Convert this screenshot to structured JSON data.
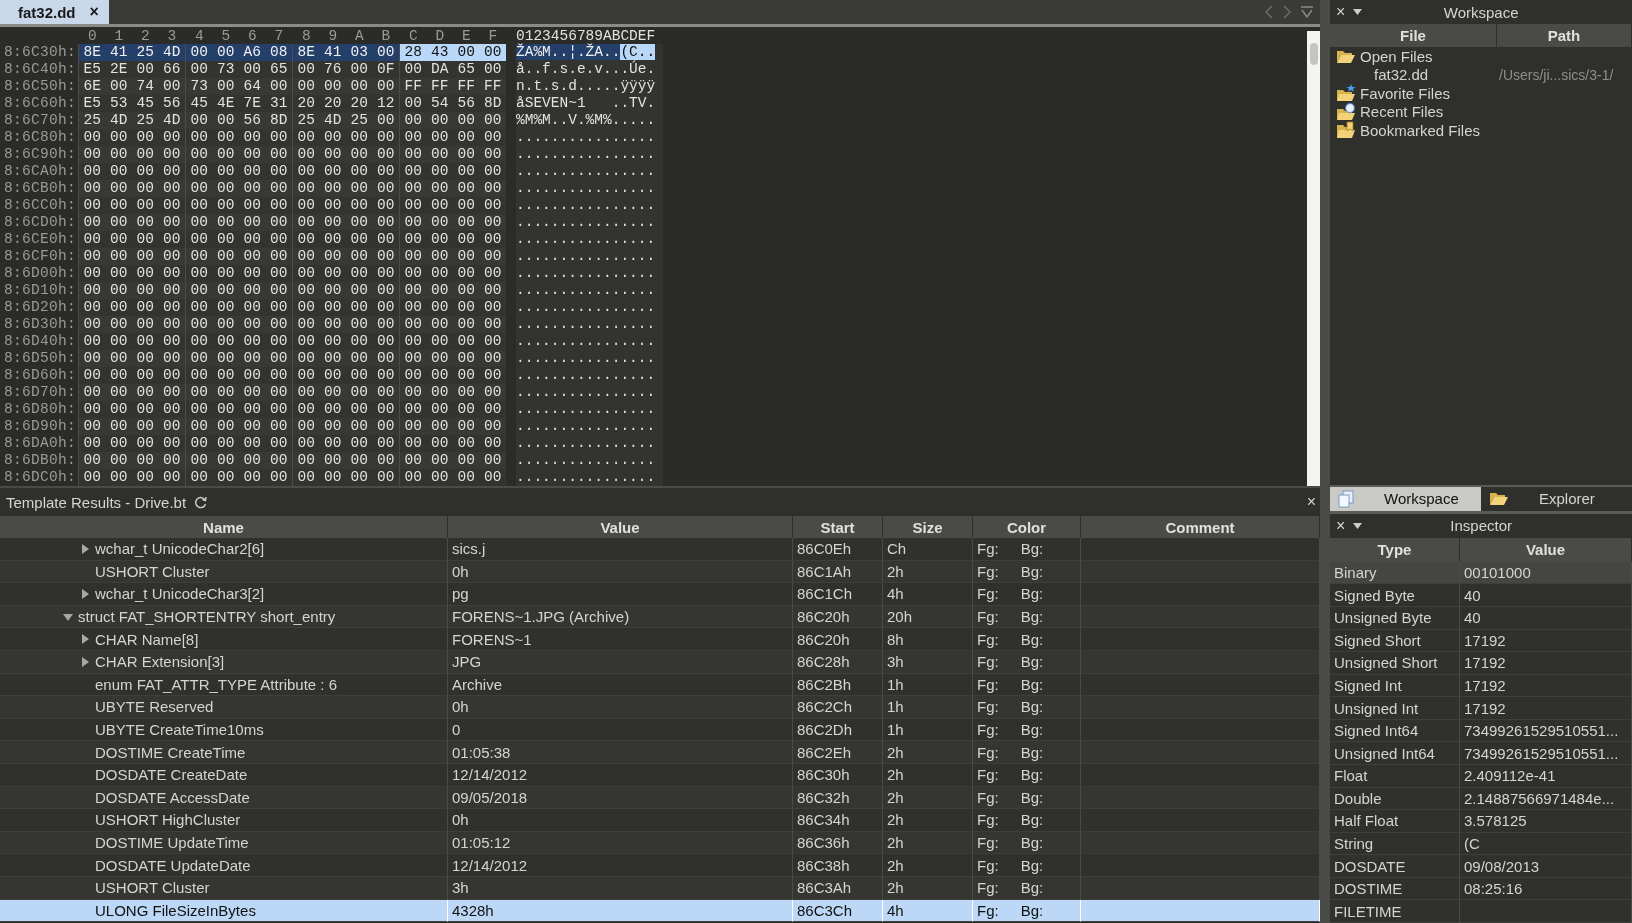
{
  "editor_tabs": [
    {
      "label": "fat32.dd",
      "close": "×",
      "selected": true
    }
  ],
  "hex_view": {
    "column_labels": [
      "0",
      "1",
      "2",
      "3",
      "4",
      "5",
      "6",
      "7",
      "8",
      "9",
      "A",
      "B",
      "C",
      "D",
      "E",
      "F"
    ],
    "ascii_header": "0123456789ABCDEF",
    "rows": [
      {
        "offset": "8:6C30h:",
        "bytes": [
          "8E",
          "41",
          "25",
          "4D",
          "00",
          "00",
          "A6",
          "08",
          "8E",
          "41",
          "03",
          "00",
          "28",
          "43",
          "00",
          "00"
        ],
        "struct_highlight": [
          true,
          true,
          true,
          true,
          true,
          true,
          true,
          true,
          true,
          true,
          true,
          true,
          false,
          false,
          false,
          false
        ],
        "cursor_highlight": [
          false,
          false,
          false,
          false,
          false,
          false,
          false,
          false,
          false,
          false,
          false,
          false,
          true,
          true,
          true,
          true
        ],
        "ascii": [
          {
            "text": "ŽA%M..¦.ŽA..",
            "struct_highlight": true,
            "cursor_highlight": false
          },
          {
            "text": "(C..",
            "struct_highlight": false,
            "cursor_highlight": true
          }
        ]
      },
      {
        "offset": "8:6C40h:",
        "bytes": [
          "E5",
          "2E",
          "00",
          "66",
          "00",
          "73",
          "00",
          "65",
          "00",
          "76",
          "00",
          "0F",
          "00",
          "DA",
          "65",
          "00"
        ],
        "ascii": [
          {
            "text": "å..f.s.e.v...Úe."
          }
        ]
      },
      {
        "offset": "8:6C50h:",
        "bytes": [
          "6E",
          "00",
          "74",
          "00",
          "73",
          "00",
          "64",
          "00",
          "00",
          "00",
          "00",
          "00",
          "FF",
          "FF",
          "FF",
          "FF"
        ],
        "ascii": [
          {
            "text": "n.t.s.d.....ÿÿÿÿ"
          }
        ]
      },
      {
        "offset": "8:6C60h:",
        "bytes": [
          "E5",
          "53",
          "45",
          "56",
          "45",
          "4E",
          "7E",
          "31",
          "20",
          "20",
          "20",
          "12",
          "00",
          "54",
          "56",
          "8D"
        ],
        "ascii": [
          {
            "text": "åSEVEN~1   ..TV."
          }
        ]
      },
      {
        "offset": "8:6C70h:",
        "bytes": [
          "25",
          "4D",
          "25",
          "4D",
          "00",
          "00",
          "56",
          "8D",
          "25",
          "4D",
          "25",
          "00",
          "00",
          "00",
          "00",
          "00"
        ],
        "ascii": [
          {
            "text": "%M%M..V.%M%....."
          }
        ]
      },
      {
        "offset": "8:6C80h:",
        "bytes": [
          "00",
          "00",
          "00",
          "00",
          "00",
          "00",
          "00",
          "00",
          "00",
          "00",
          "00",
          "00",
          "00",
          "00",
          "00",
          "00"
        ],
        "ascii": [
          {
            "text": "................"
          }
        ]
      },
      {
        "offset": "8:6C90h:",
        "bytes": [
          "00",
          "00",
          "00",
          "00",
          "00",
          "00",
          "00",
          "00",
          "00",
          "00",
          "00",
          "00",
          "00",
          "00",
          "00",
          "00"
        ],
        "ascii": [
          {
            "text": "................"
          }
        ]
      },
      {
        "offset": "8:6CA0h:",
        "bytes": [
          "00",
          "00",
          "00",
          "00",
          "00",
          "00",
          "00",
          "00",
          "00",
          "00",
          "00",
          "00",
          "00",
          "00",
          "00",
          "00"
        ],
        "ascii": [
          {
            "text": "................"
          }
        ]
      },
      {
        "offset": "8:6CB0h:",
        "bytes": [
          "00",
          "00",
          "00",
          "00",
          "00",
          "00",
          "00",
          "00",
          "00",
          "00",
          "00",
          "00",
          "00",
          "00",
          "00",
          "00"
        ],
        "ascii": [
          {
            "text": "................"
          }
        ]
      },
      {
        "offset": "8:6CC0h:",
        "bytes": [
          "00",
          "00",
          "00",
          "00",
          "00",
          "00",
          "00",
          "00",
          "00",
          "00",
          "00",
          "00",
          "00",
          "00",
          "00",
          "00"
        ],
        "ascii": [
          {
            "text": "................"
          }
        ]
      },
      {
        "offset": "8:6CD0h:",
        "bytes": [
          "00",
          "00",
          "00",
          "00",
          "00",
          "00",
          "00",
          "00",
          "00",
          "00",
          "00",
          "00",
          "00",
          "00",
          "00",
          "00"
        ],
        "ascii": [
          {
            "text": "................"
          }
        ]
      },
      {
        "offset": "8:6CE0h:",
        "bytes": [
          "00",
          "00",
          "00",
          "00",
          "00",
          "00",
          "00",
          "00",
          "00",
          "00",
          "00",
          "00",
          "00",
          "00",
          "00",
          "00"
        ],
        "ascii": [
          {
            "text": "................"
          }
        ]
      },
      {
        "offset": "8:6CF0h:",
        "bytes": [
          "00",
          "00",
          "00",
          "00",
          "00",
          "00",
          "00",
          "00",
          "00",
          "00",
          "00",
          "00",
          "00",
          "00",
          "00",
          "00"
        ],
        "ascii": [
          {
            "text": "................"
          }
        ]
      },
      {
        "offset": "8:6D00h:",
        "bytes": [
          "00",
          "00",
          "00",
          "00",
          "00",
          "00",
          "00",
          "00",
          "00",
          "00",
          "00",
          "00",
          "00",
          "00",
          "00",
          "00"
        ],
        "ascii": [
          {
            "text": "................"
          }
        ]
      },
      {
        "offset": "8:6D10h:",
        "bytes": [
          "00",
          "00",
          "00",
          "00",
          "00",
          "00",
          "00",
          "00",
          "00",
          "00",
          "00",
          "00",
          "00",
          "00",
          "00",
          "00"
        ],
        "ascii": [
          {
            "text": "................"
          }
        ]
      },
      {
        "offset": "8:6D20h:",
        "bytes": [
          "00",
          "00",
          "00",
          "00",
          "00",
          "00",
          "00",
          "00",
          "00",
          "00",
          "00",
          "00",
          "00",
          "00",
          "00",
          "00"
        ],
        "ascii": [
          {
            "text": "................"
          }
        ]
      },
      {
        "offset": "8:6D30h:",
        "bytes": [
          "00",
          "00",
          "00",
          "00",
          "00",
          "00",
          "00",
          "00",
          "00",
          "00",
          "00",
          "00",
          "00",
          "00",
          "00",
          "00"
        ],
        "ascii": [
          {
            "text": "................"
          }
        ]
      },
      {
        "offset": "8:6D40h:",
        "bytes": [
          "00",
          "00",
          "00",
          "00",
          "00",
          "00",
          "00",
          "00",
          "00",
          "00",
          "00",
          "00",
          "00",
          "00",
          "00",
          "00"
        ],
        "ascii": [
          {
            "text": "................"
          }
        ]
      },
      {
        "offset": "8:6D50h:",
        "bytes": [
          "00",
          "00",
          "00",
          "00",
          "00",
          "00",
          "00",
          "00",
          "00",
          "00",
          "00",
          "00",
          "00",
          "00",
          "00",
          "00"
        ],
        "ascii": [
          {
            "text": "................"
          }
        ]
      },
      {
        "offset": "8:6D60h:",
        "bytes": [
          "00",
          "00",
          "00",
          "00",
          "00",
          "00",
          "00",
          "00",
          "00",
          "00",
          "00",
          "00",
          "00",
          "00",
          "00",
          "00"
        ],
        "ascii": [
          {
            "text": "................"
          }
        ]
      },
      {
        "offset": "8:6D70h:",
        "bytes": [
          "00",
          "00",
          "00",
          "00",
          "00",
          "00",
          "00",
          "00",
          "00",
          "00",
          "00",
          "00",
          "00",
          "00",
          "00",
          "00"
        ],
        "ascii": [
          {
            "text": "................"
          }
        ]
      },
      {
        "offset": "8:6D80h:",
        "bytes": [
          "00",
          "00",
          "00",
          "00",
          "00",
          "00",
          "00",
          "00",
          "00",
          "00",
          "00",
          "00",
          "00",
          "00",
          "00",
          "00"
        ],
        "ascii": [
          {
            "text": "................"
          }
        ]
      },
      {
        "offset": "8:6D90h:",
        "bytes": [
          "00",
          "00",
          "00",
          "00",
          "00",
          "00",
          "00",
          "00",
          "00",
          "00",
          "00",
          "00",
          "00",
          "00",
          "00",
          "00"
        ],
        "ascii": [
          {
            "text": "................"
          }
        ]
      },
      {
        "offset": "8:6DA0h:",
        "bytes": [
          "00",
          "00",
          "00",
          "00",
          "00",
          "00",
          "00",
          "00",
          "00",
          "00",
          "00",
          "00",
          "00",
          "00",
          "00",
          "00"
        ],
        "ascii": [
          {
            "text": "................"
          }
        ]
      },
      {
        "offset": "8:6DB0h:",
        "bytes": [
          "00",
          "00",
          "00",
          "00",
          "00",
          "00",
          "00",
          "00",
          "00",
          "00",
          "00",
          "00",
          "00",
          "00",
          "00",
          "00"
        ],
        "ascii": [
          {
            "text": "................"
          }
        ]
      },
      {
        "offset": "8:6DC0h:",
        "bytes": [
          "00",
          "00",
          "00",
          "00",
          "00",
          "00",
          "00",
          "00",
          "00",
          "00",
          "00",
          "00",
          "00",
          "00",
          "00",
          "00"
        ],
        "ascii": [
          {
            "text": "................"
          }
        ]
      }
    ]
  },
  "template_results": {
    "title": "Template Results - Drive.bt",
    "close": "×",
    "columns": [
      "Name",
      "Value",
      "Start",
      "Size",
      "Color",
      "Comment"
    ],
    "rows": [
      {
        "children": [
          {
            "name": "wchar_t UnicodeChar2[6]",
            "value": "sics.j",
            "start": "86C0Eh",
            "size": "Ch",
            "fg": "Fg:",
            "bg": "Bg:",
            "expanded": false,
            "selected": false
          },
          {
            "name": "USHORT Cluster",
            "value": "0h",
            "start": "86C1Ah",
            "size": "2h",
            "fg": "Fg:",
            "bg": "Bg:",
            "selected": false
          },
          {
            "name": "wchar_t UnicodeChar3[2]",
            "value": "pg",
            "start": "86C1Ch",
            "size": "4h",
            "fg": "Fg:",
            "bg": "Bg:",
            "expanded": false,
            "selected": false
          }
        ]
      },
      {
        "name": "struct FAT_SHORTENTRY short_entry",
        "value": "FORENS~1.JPG (Archive)",
        "start": "86C20h",
        "size": "20h",
        "fg": "Fg:",
        "bg": "Bg:",
        "expanded": true,
        "selected": false,
        "children": [
          {
            "name": "CHAR Name[8]",
            "value": "FORENS~1",
            "start": "86C20h",
            "size": "8h",
            "fg": "Fg:",
            "bg": "Bg:",
            "expanded": false,
            "selected": false
          },
          {
            "name": "CHAR Extension[3]",
            "value": "JPG",
            "start": "86C28h",
            "size": "3h",
            "fg": "Fg:",
            "bg": "Bg:",
            "expanded": false,
            "selected": false
          },
          {
            "name": "enum FAT_ATTR_TYPE Attribute : 6",
            "value": "Archive",
            "start": "86C2Bh",
            "size": "1h",
            "fg": "Fg:",
            "bg": "Bg:",
            "selected": false
          },
          {
            "name": "UBYTE Reserved",
            "value": "0h",
            "start": "86C2Ch",
            "size": "1h",
            "fg": "Fg:",
            "bg": "Bg:",
            "selected": false
          },
          {
            "name": "UBYTE CreateTime10ms",
            "value": "0",
            "start": "86C2Dh",
            "size": "1h",
            "fg": "Fg:",
            "bg": "Bg:",
            "selected": false
          },
          {
            "name": "DOSTIME CreateTime",
            "value": "01:05:38",
            "start": "86C2Eh",
            "size": "2h",
            "fg": "Fg:",
            "bg": "Bg:",
            "selected": false
          },
          {
            "name": "DOSDATE CreateDate",
            "value": "12/14/2012",
            "start": "86C30h",
            "size": "2h",
            "fg": "Fg:",
            "bg": "Bg:",
            "selected": false
          },
          {
            "name": "DOSDATE AccessDate",
            "value": "09/05/2018",
            "start": "86C32h",
            "size": "2h",
            "fg": "Fg:",
            "bg": "Bg:",
            "selected": false
          },
          {
            "name": "USHORT HighCluster",
            "value": "0h",
            "start": "86C34h",
            "size": "2h",
            "fg": "Fg:",
            "bg": "Bg:",
            "selected": false
          },
          {
            "name": "DOSTIME UpdateTime",
            "value": "01:05:12",
            "start": "86C36h",
            "size": "2h",
            "fg": "Fg:",
            "bg": "Bg:",
            "selected": false
          },
          {
            "name": "DOSDATE UpdateDate",
            "value": "12/14/2012",
            "start": "86C38h",
            "size": "2h",
            "fg": "Fg:",
            "bg": "Bg:",
            "selected": false
          },
          {
            "name": "USHORT Cluster",
            "value": "3h",
            "start": "86C3Ah",
            "size": "2h",
            "fg": "Fg:",
            "bg": "Bg:",
            "selected": false
          },
          {
            "name": "ULONG FileSizeInBytes",
            "value": "4328h",
            "start": "86C3Ch",
            "size": "4h",
            "fg": "Fg:",
            "bg": "Bg:",
            "selected": true
          }
        ]
      }
    ]
  },
  "workspace": {
    "title": "Workspace",
    "close": "×",
    "columns": [
      "File",
      "Path"
    ],
    "items": [
      {
        "label": "Open Files",
        "kind": "open",
        "children": [
          {
            "label": "fat32.dd",
            "path": "/Users/ji...sics/3-1/"
          }
        ]
      },
      {
        "label": "Favorite Files",
        "kind": "favorite"
      },
      {
        "label": "Recent Files",
        "kind": "recent"
      },
      {
        "label": "Bookmarked Files",
        "kind": "bookmarked"
      }
    ]
  },
  "panel_tabs": [
    {
      "label": "Workspace",
      "kind": "workspace",
      "selected": true
    },
    {
      "label": "Explorer",
      "kind": "explorer",
      "selected": false
    }
  ],
  "inspector": {
    "title": "Inspector",
    "close": "×",
    "columns": [
      "Type",
      "Value"
    ],
    "rows": [
      {
        "type": "Binary",
        "value": "00101000",
        "selected": true
      },
      {
        "type": "Signed Byte",
        "value": "40",
        "selected": false
      },
      {
        "type": "Unsigned Byte",
        "value": "40",
        "selected": false
      },
      {
        "type": "Signed Short",
        "value": "17192",
        "selected": false
      },
      {
        "type": "Unsigned Short",
        "value": "17192",
        "selected": false
      },
      {
        "type": "Signed Int",
        "value": "17192",
        "selected": false
      },
      {
        "type": "Unsigned Int",
        "value": "17192",
        "selected": false
      },
      {
        "type": "Signed Int64",
        "value": "73499261529510551...",
        "selected": false
      },
      {
        "type": "Unsigned Int64",
        "value": "73499261529510551...",
        "selected": false
      },
      {
        "type": "Float",
        "value": "2.409112e-41",
        "selected": false
      },
      {
        "type": "Double",
        "value": "2.14887566971484e...",
        "selected": false
      },
      {
        "type": "Half Float",
        "value": "3.578125",
        "selected": false
      },
      {
        "type": "String",
        "value": "(C",
        "selected": false
      },
      {
        "type": "DOSDATE",
        "value": "09/08/2013",
        "selected": false
      },
      {
        "type": "DOSTIME",
        "value": "08:25:16",
        "selected": false
      },
      {
        "type": "FILETIME",
        "selected": false
      }
    ]
  }
}
